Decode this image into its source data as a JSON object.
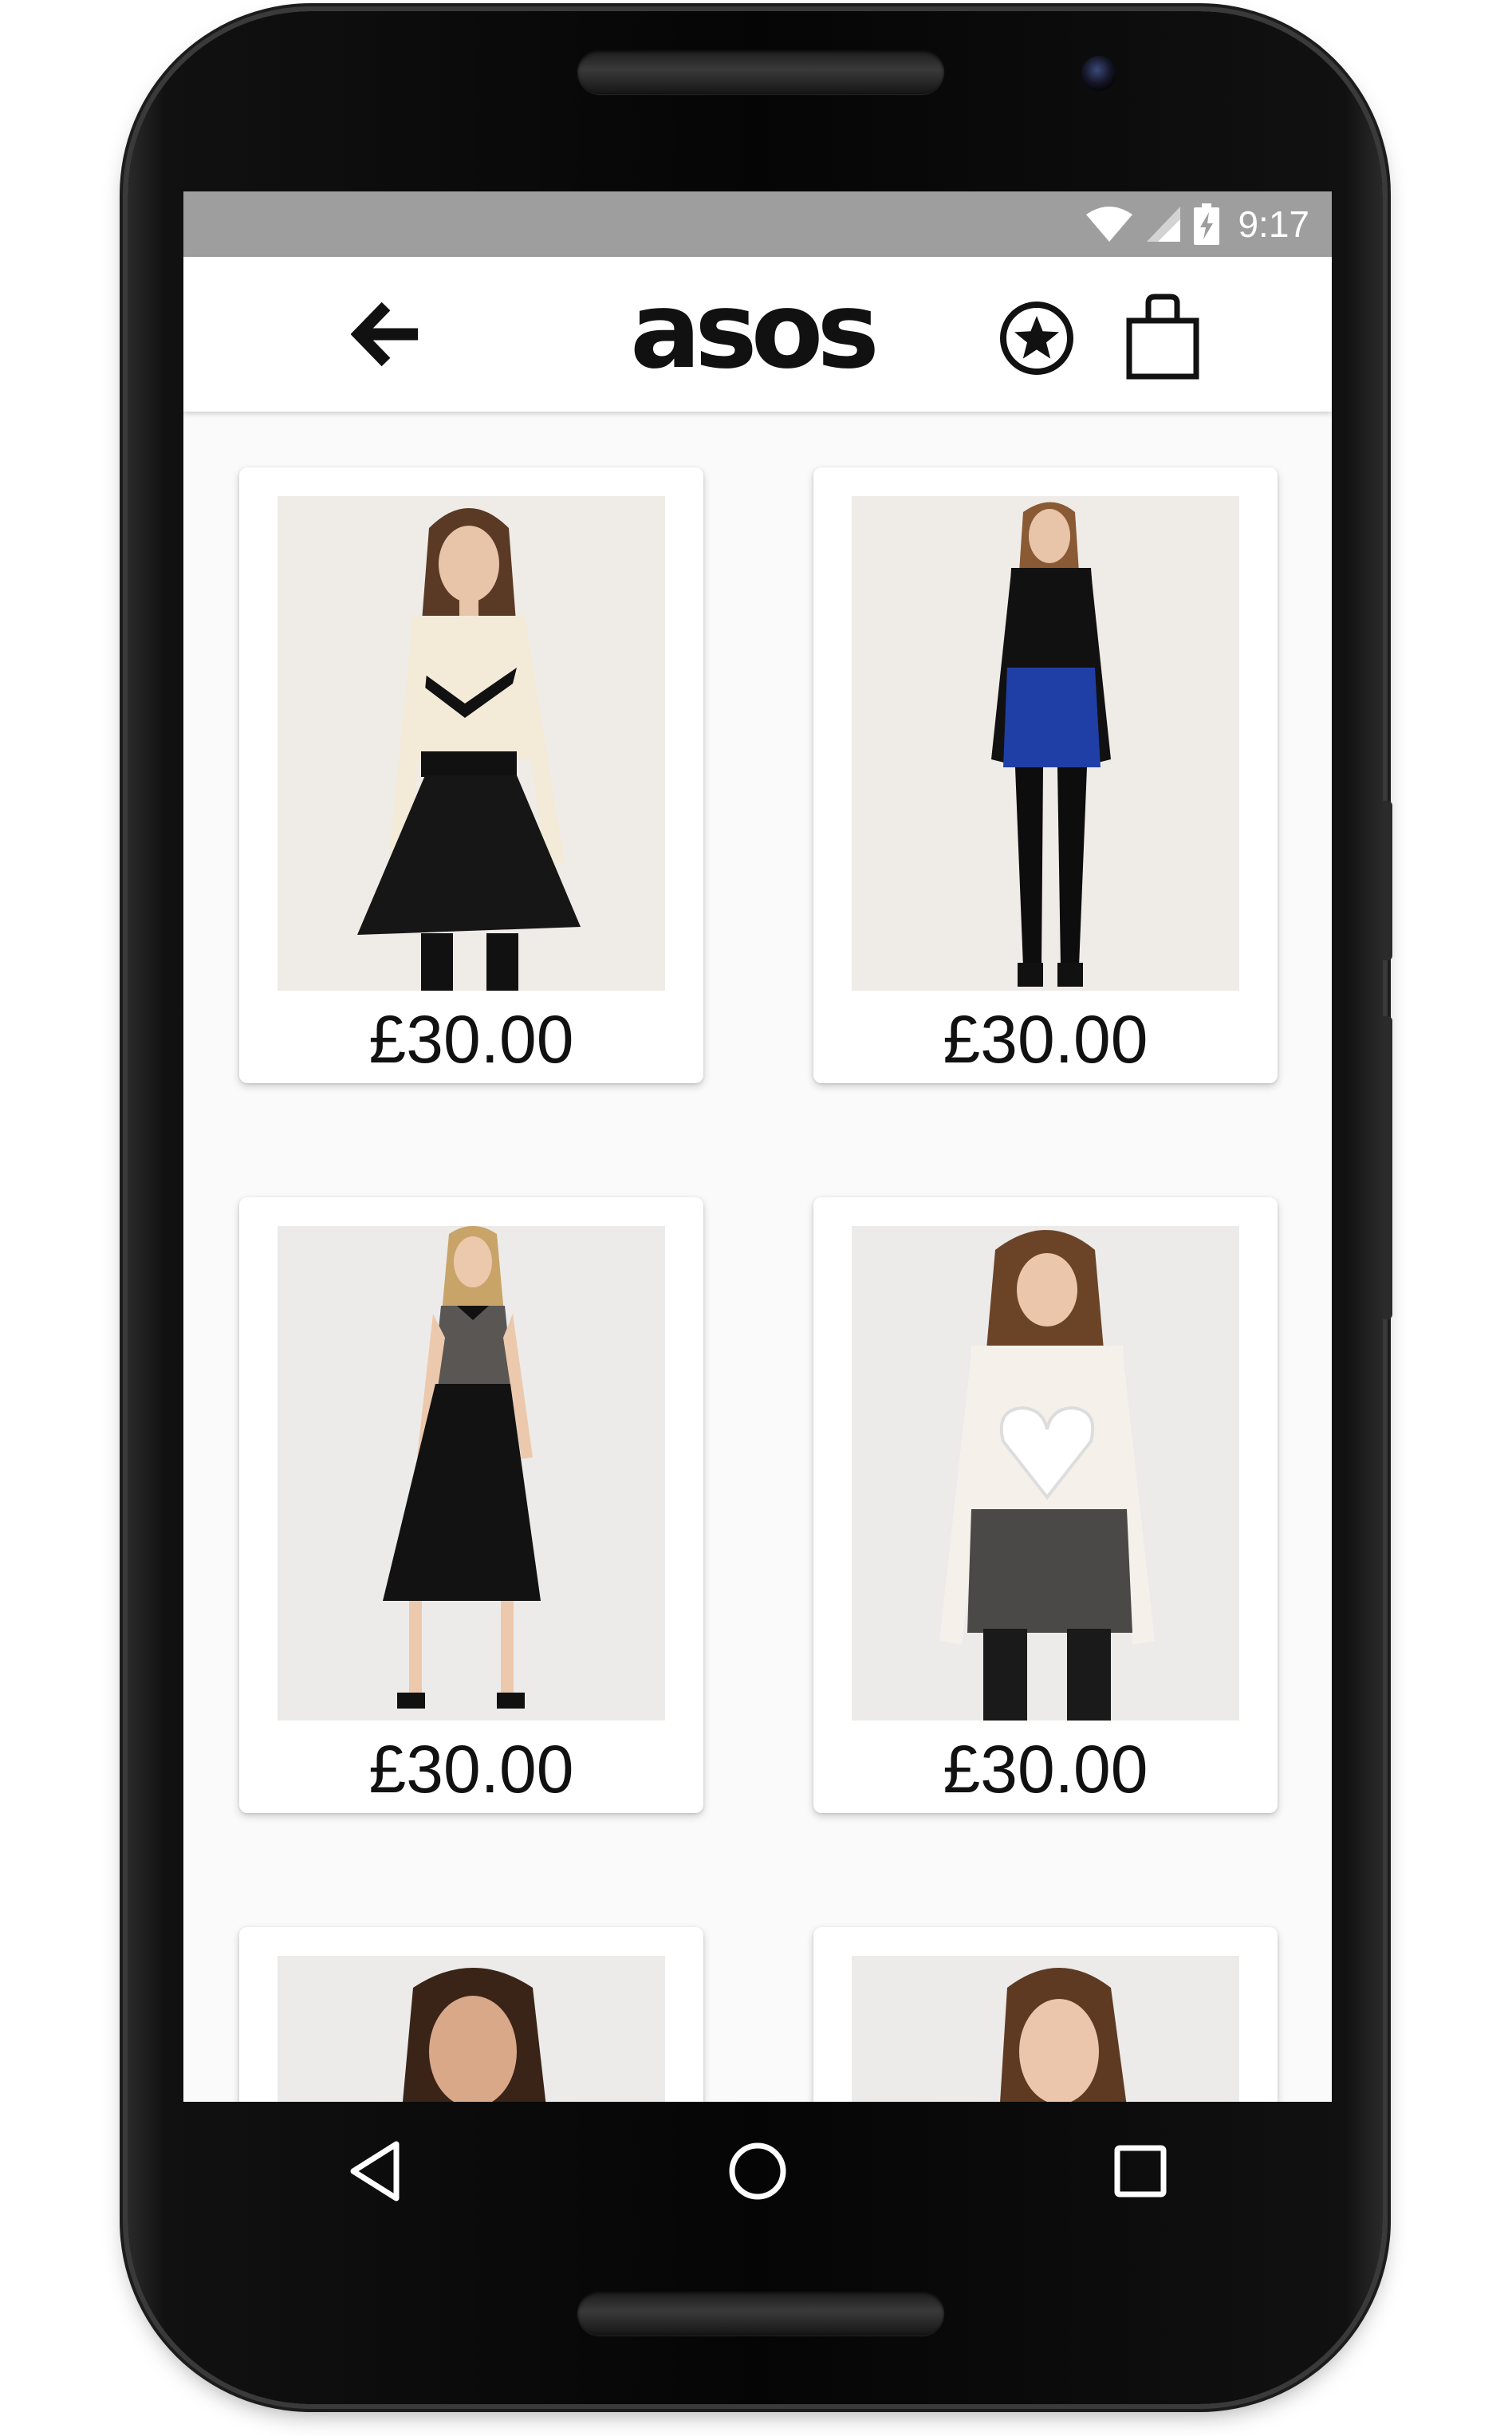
{
  "status_bar": {
    "time": "9:17",
    "icons": [
      "wifi-icon",
      "cell-signal-icon",
      "battery-charging-icon"
    ]
  },
  "app_bar": {
    "logo_text": "asos",
    "icons": [
      "back-arrow-icon",
      "star-circle-icon",
      "shopping-bag-icon"
    ]
  },
  "products": [
    {
      "price": "£30.00",
      "image": "model in cream blouse with black collar and black pleated skirt"
    },
    {
      "price": "£30.00",
      "image": "model in black turtleneck, blue mini skirt and black tights"
    },
    {
      "price": "£30.00",
      "image": "model in polka-dot sleeveless top with black midi skirt"
    },
    {
      "price": "£30.00",
      "image": "model in white heart-panel blouse and grey tweed shorts"
    },
    {
      "price": "",
      "image": "partially visible model portrait"
    },
    {
      "price": "",
      "image": "partially visible model portrait"
    }
  ],
  "nav_bar": {
    "icons": [
      "back-triangle-icon",
      "home-circle-icon",
      "recents-square-icon"
    ]
  },
  "colors": {
    "status_bar": "#9e9e9e",
    "app_bar": "#ffffff",
    "content_bg": "#fafafa",
    "text": "#111111"
  }
}
